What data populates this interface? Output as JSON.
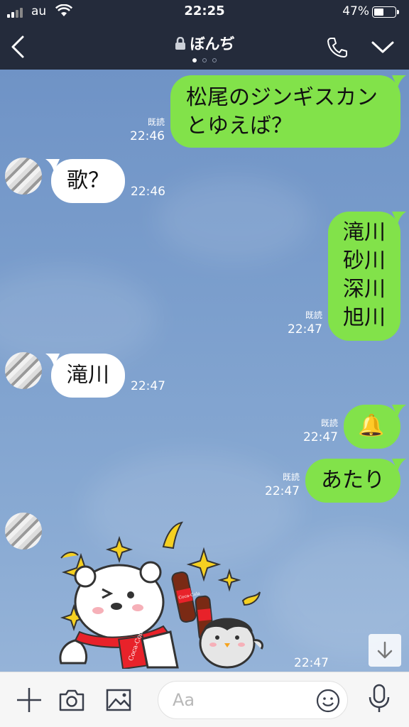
{
  "status": {
    "carrier": "au",
    "time": "22:25",
    "battery": "47%"
  },
  "header": {
    "title": "ぼんぢ"
  },
  "messages": {
    "m1": {
      "lines": [
        "松尾のジンギスカン",
        "とゆえば？"
      ],
      "read": "既読",
      "time": "22:46"
    },
    "m2": {
      "text": "歌？",
      "time": "22:46"
    },
    "m3": {
      "lines": [
        "滝川",
        "砂川",
        "深川",
        "旭川"
      ],
      "read": "既読",
      "time": "22:47"
    },
    "m4": {
      "text": "滝川",
      "time": "22:47"
    },
    "m5": {
      "text": "🔔",
      "read": "既読",
      "time": "22:47"
    },
    "m6": {
      "text": "あたり",
      "read": "既読",
      "time": "22:47"
    },
    "m7": {
      "time": "22:47"
    }
  },
  "sticker": {
    "scarf_text": "Coca-Cola",
    "bottle_text": "Coca-Cola"
  },
  "input": {
    "placeholder": "Aa"
  },
  "colors": {
    "header_bg": "#242b3b",
    "outgoing": "#82e24a",
    "incoming": "#ffffff",
    "chat_bg": "#7a9ac6"
  }
}
